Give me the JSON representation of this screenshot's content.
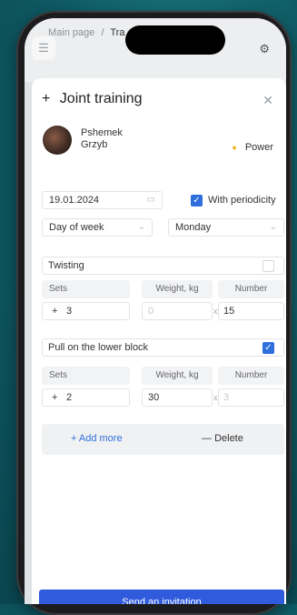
{
  "header": {
    "breadcrumb_root": "Main page",
    "breadcrumb_sep": "/",
    "breadcrumb_current": "Tra"
  },
  "modal": {
    "title": "Joint training",
    "user": {
      "first": "Pshemek",
      "last": "Grzyb"
    },
    "tag": "Power",
    "date": "19.01.2024",
    "periodicity_label": "With periodicity",
    "periodicity_checked": true,
    "period_unit": "Day of week",
    "period_day": "Monday",
    "exercises": [
      {
        "name": "Twisting",
        "checked": false,
        "sets_label": "Sets",
        "weight_label": "Weight, kg",
        "number_label": "Number",
        "sets": "3",
        "weight_placeholder": "0",
        "weight": "",
        "number": "15"
      },
      {
        "name": "Pull on the lower block",
        "checked": true,
        "sets_label": "Sets",
        "weight_label": "Weight, kg",
        "number_label": "Number",
        "sets": "2",
        "weight": "30",
        "number_placeholder": "3"
      }
    ],
    "add_more_label": "Add more",
    "delete_label": "Delete",
    "send_label": "Send an invitation"
  },
  "icons": {
    "menu": "menu-icon",
    "gear": "gear-icon",
    "close": "close-icon",
    "calendar": "calendar-icon",
    "chevron": "chevron-down-icon",
    "plus": "plus-icon",
    "minus": "minus-icon",
    "check": "check-icon"
  },
  "colors": {
    "accent": "#2f6fdc",
    "button": "#2f5bdc",
    "tag_dot": "#f0b429"
  }
}
